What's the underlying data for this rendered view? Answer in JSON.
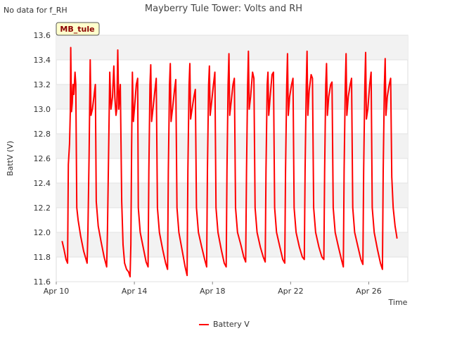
{
  "notice": "No data for f_RH",
  "chart_data": {
    "type": "line",
    "title": "Mayberry Tule Tower: Volts and RH",
    "xlabel": "Time",
    "ylabel": "BattV (V)",
    "badge": "MB_tule",
    "xlim": [
      0,
      18
    ],
    "ylim": [
      11.6,
      13.6
    ],
    "y_ticks": [
      "11.6",
      "11.8",
      "12.0",
      "12.2",
      "12.4",
      "12.6",
      "12.8",
      "13.0",
      "13.2",
      "13.4",
      "13.6"
    ],
    "x_ticks": [
      {
        "label": "Apr 10",
        "day": 0
      },
      {
        "label": "Apr 14",
        "day": 4
      },
      {
        "label": "Apr 18",
        "day": 8
      },
      {
        "label": "Apr 22",
        "day": 12
      },
      {
        "label": "Apr 26",
        "day": 16
      }
    ],
    "grid": true,
    "legend": "bottom-center",
    "series": [
      {
        "name": "Battery V",
        "color": "#ff0000",
        "points": [
          [
            0.3,
            11.93
          ],
          [
            0.4,
            11.86
          ],
          [
            0.5,
            11.78
          ],
          [
            0.58,
            11.75
          ],
          [
            0.62,
            12.55
          ],
          [
            0.68,
            12.72
          ],
          [
            0.72,
            12.98
          ],
          [
            0.74,
            13.5
          ],
          [
            0.78,
            12.98
          ],
          [
            0.82,
            13.05
          ],
          [
            0.86,
            13.2
          ],
          [
            0.9,
            13.12
          ],
          [
            0.96,
            13.3
          ],
          [
            1.0,
            13.2
          ],
          [
            1.05,
            12.2
          ],
          [
            1.12,
            12.1
          ],
          [
            1.25,
            11.97
          ],
          [
            1.4,
            11.85
          ],
          [
            1.58,
            11.75
          ],
          [
            1.62,
            12.0
          ],
          [
            1.68,
            12.62
          ],
          [
            1.74,
            13.4
          ],
          [
            1.78,
            12.95
          ],
          [
            1.85,
            13.0
          ],
          [
            1.93,
            13.1
          ],
          [
            2.0,
            13.2
          ],
          [
            2.05,
            12.25
          ],
          [
            2.15,
            12.05
          ],
          [
            2.3,
            11.92
          ],
          [
            2.45,
            11.8
          ],
          [
            2.58,
            11.72
          ],
          [
            2.62,
            12.0
          ],
          [
            2.68,
            12.62
          ],
          [
            2.74,
            13.3
          ],
          [
            2.8,
            13.0
          ],
          [
            2.88,
            13.1
          ],
          [
            2.95,
            13.35
          ],
          [
            3.0,
            13.1
          ],
          [
            3.06,
            12.95
          ],
          [
            3.1,
            13.0
          ],
          [
            3.15,
            13.48
          ],
          [
            3.2,
            13.0
          ],
          [
            3.28,
            13.2
          ],
          [
            3.35,
            12.25
          ],
          [
            3.42,
            11.9
          ],
          [
            3.5,
            11.75
          ],
          [
            3.6,
            11.7
          ],
          [
            3.7,
            11.68
          ],
          [
            3.78,
            11.64
          ],
          [
            3.82,
            11.9
          ],
          [
            3.86,
            12.7
          ],
          [
            3.9,
            13.3
          ],
          [
            3.95,
            12.9
          ],
          [
            4.0,
            13.0
          ],
          [
            4.1,
            13.2
          ],
          [
            4.17,
            13.25
          ],
          [
            4.2,
            12.2
          ],
          [
            4.3,
            12.0
          ],
          [
            4.45,
            11.88
          ],
          [
            4.6,
            11.76
          ],
          [
            4.7,
            11.72
          ],
          [
            4.74,
            12.5
          ],
          [
            4.8,
            13.2
          ],
          [
            4.84,
            13.36
          ],
          [
            4.88,
            12.9
          ],
          [
            4.95,
            13.0
          ],
          [
            5.05,
            13.15
          ],
          [
            5.12,
            13.25
          ],
          [
            5.18,
            12.2
          ],
          [
            5.28,
            12.0
          ],
          [
            5.45,
            11.86
          ],
          [
            5.6,
            11.75
          ],
          [
            5.7,
            11.7
          ],
          [
            5.74,
            12.5
          ],
          [
            5.8,
            13.2
          ],
          [
            5.84,
            13.37
          ],
          [
            5.88,
            12.9
          ],
          [
            5.95,
            13.0
          ],
          [
            6.05,
            13.15
          ],
          [
            6.12,
            13.24
          ],
          [
            6.18,
            12.2
          ],
          [
            6.28,
            12.0
          ],
          [
            6.45,
            11.85
          ],
          [
            6.6,
            11.72
          ],
          [
            6.7,
            11.65
          ],
          [
            6.74,
            12.5
          ],
          [
            6.8,
            13.2
          ],
          [
            6.84,
            13.37
          ],
          [
            6.88,
            12.92
          ],
          [
            6.95,
            13.0
          ],
          [
            7.05,
            13.1
          ],
          [
            7.12,
            13.16
          ],
          [
            7.18,
            12.2
          ],
          [
            7.28,
            12.0
          ],
          [
            7.45,
            11.88
          ],
          [
            7.6,
            11.78
          ],
          [
            7.7,
            11.72
          ],
          [
            7.74,
            12.5
          ],
          [
            7.8,
            13.2
          ],
          [
            7.84,
            13.35
          ],
          [
            7.88,
            12.95
          ],
          [
            7.95,
            13.05
          ],
          [
            8.05,
            13.2
          ],
          [
            8.12,
            13.3
          ],
          [
            8.18,
            12.2
          ],
          [
            8.28,
            12.0
          ],
          [
            8.45,
            11.86
          ],
          [
            8.6,
            11.75
          ],
          [
            8.7,
            11.72
          ],
          [
            8.74,
            12.5
          ],
          [
            8.8,
            13.2
          ],
          [
            8.84,
            13.45
          ],
          [
            8.88,
            12.95
          ],
          [
            8.95,
            13.05
          ],
          [
            9.05,
            13.2
          ],
          [
            9.12,
            13.25
          ],
          [
            9.18,
            12.2
          ],
          [
            9.28,
            12.0
          ],
          [
            9.45,
            11.9
          ],
          [
            9.6,
            11.8
          ],
          [
            9.7,
            11.76
          ],
          [
            9.74,
            12.5
          ],
          [
            9.8,
            13.2
          ],
          [
            9.84,
            13.47
          ],
          [
            9.88,
            13.0
          ],
          [
            9.95,
            13.1
          ],
          [
            10.05,
            13.3
          ],
          [
            10.12,
            13.25
          ],
          [
            10.18,
            12.2
          ],
          [
            10.28,
            12.0
          ],
          [
            10.45,
            11.88
          ],
          [
            10.6,
            11.8
          ],
          [
            10.7,
            11.76
          ],
          [
            10.74,
            12.5
          ],
          [
            10.8,
            13.2
          ],
          [
            10.84,
            13.3
          ],
          [
            10.88,
            12.95
          ],
          [
            10.95,
            13.1
          ],
          [
            11.05,
            13.28
          ],
          [
            11.12,
            13.3
          ],
          [
            11.18,
            12.2
          ],
          [
            11.28,
            12.0
          ],
          [
            11.45,
            11.88
          ],
          [
            11.6,
            11.78
          ],
          [
            11.7,
            11.75
          ],
          [
            11.74,
            12.5
          ],
          [
            11.8,
            13.2
          ],
          [
            11.84,
            13.45
          ],
          [
            11.88,
            12.95
          ],
          [
            11.95,
            13.1
          ],
          [
            12.05,
            13.2
          ],
          [
            12.12,
            13.25
          ],
          [
            12.18,
            12.2
          ],
          [
            12.28,
            12.0
          ],
          [
            12.45,
            11.88
          ],
          [
            12.6,
            11.8
          ],
          [
            12.7,
            11.78
          ],
          [
            12.74,
            12.5
          ],
          [
            12.8,
            13.2
          ],
          [
            12.84,
            13.47
          ],
          [
            12.88,
            12.95
          ],
          [
            12.95,
            13.15
          ],
          [
            13.05,
            13.28
          ],
          [
            13.12,
            13.25
          ],
          [
            13.18,
            12.2
          ],
          [
            13.28,
            12.0
          ],
          [
            13.45,
            11.88
          ],
          [
            13.6,
            11.8
          ],
          [
            13.7,
            11.78
          ],
          [
            13.74,
            12.5
          ],
          [
            13.8,
            13.2
          ],
          [
            13.84,
            13.37
          ],
          [
            13.88,
            12.95
          ],
          [
            13.95,
            13.1
          ],
          [
            14.05,
            13.2
          ],
          [
            14.12,
            13.22
          ],
          [
            14.18,
            12.2
          ],
          [
            14.28,
            12.0
          ],
          [
            14.45,
            11.88
          ],
          [
            14.6,
            11.78
          ],
          [
            14.7,
            11.72
          ],
          [
            14.74,
            12.5
          ],
          [
            14.8,
            13.2
          ],
          [
            14.84,
            13.45
          ],
          [
            14.88,
            12.95
          ],
          [
            14.95,
            13.1
          ],
          [
            15.05,
            13.2
          ],
          [
            15.12,
            13.25
          ],
          [
            15.18,
            12.2
          ],
          [
            15.28,
            12.0
          ],
          [
            15.45,
            11.88
          ],
          [
            15.6,
            11.78
          ],
          [
            15.7,
            11.74
          ],
          [
            15.74,
            12.5
          ],
          [
            15.8,
            13.2
          ],
          [
            15.84,
            13.46
          ],
          [
            15.88,
            12.92
          ],
          [
            15.95,
            13.0
          ],
          [
            16.05,
            13.2
          ],
          [
            16.12,
            13.3
          ],
          [
            16.18,
            12.2
          ],
          [
            16.28,
            12.0
          ],
          [
            16.45,
            11.86
          ],
          [
            16.6,
            11.75
          ],
          [
            16.7,
            11.7
          ],
          [
            16.74,
            12.5
          ],
          [
            16.8,
            13.2
          ],
          [
            16.84,
            13.41
          ],
          [
            16.88,
            12.95
          ],
          [
            16.95,
            13.1
          ],
          [
            17.05,
            13.2
          ],
          [
            17.12,
            13.25
          ],
          [
            17.18,
            12.45
          ],
          [
            17.25,
            12.2
          ],
          [
            17.35,
            12.05
          ],
          [
            17.42,
            11.98
          ],
          [
            17.45,
            11.95
          ]
        ]
      }
    ]
  }
}
